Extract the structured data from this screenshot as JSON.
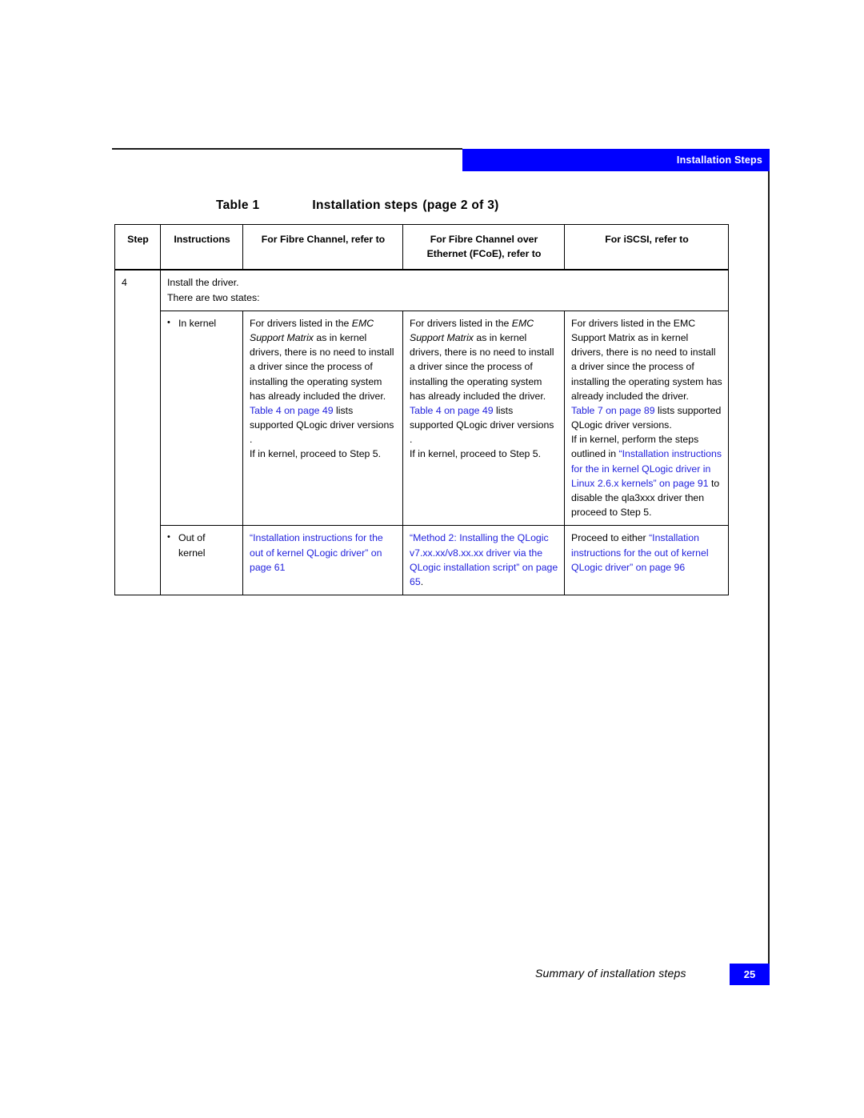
{
  "header": {
    "banner_label": "Installation Steps"
  },
  "caption": {
    "number": "Table 1",
    "title": "Installation steps",
    "continuation": "(page 2 of 3)"
  },
  "table": {
    "columns": [
      "Step",
      "Instructions",
      "For Fibre Channel, refer to",
      "For Fibre Channel over Ethernet (FCoE), refer to",
      "For iSCSI, refer to"
    ],
    "column_fcoe_line1": "For Fibre Channel over",
    "column_fcoe_line2": "Ethernet (FCoE), refer to",
    "step_number": "4",
    "intro_line1": "Install the driver.",
    "intro_line2": "There are two states:",
    "rows": [
      {
        "bullet": "•",
        "state_label": "In kernel",
        "fibre_channel": {
          "p1_a": "For drivers listed in the ",
          "p1_italic": "EMC Support Matrix",
          "p1_b": " as in kernel drivers, there is no need to install a driver since the process of installing the operating system has already included the driver.",
          "p2_link": "Table 4 on page 49",
          "p2_rest": " lists supported QLogic driver versions .",
          "p3": "If in kernel, proceed to Step 5."
        },
        "fcoe": {
          "p1_a": "For drivers listed in the ",
          "p1_italic": "EMC Support Matrix",
          "p1_b": " as in kernel drivers, there is no need to install a driver since the process of installing the operating system has already included the driver.",
          "p2_link": "Table 4 on page 49",
          "p2_rest": " lists supported QLogic driver versions .",
          "p3": "If in kernel, proceed to Step 5."
        },
        "iscsi": {
          "p1": "For drivers listed in the EMC Support Matrix as in kernel drivers, there is no need to install a driver since the process of installing the operating system has already included the driver.",
          "p2_link": "Table 7 on page 89",
          "p2_rest": " lists supported QLogic driver versions.",
          "p3_a": "If in kernel, perform the steps outlined in ",
          "p3_link": "“Installation instructions for the in kernel QLogic driver in Linux 2.6.x kernels” on page 91",
          "p3_b": " to disable the qla3xxx driver then proceed to Step 5."
        }
      },
      {
        "bullet": "•",
        "state_label_line1": "Out of",
        "state_label_line2": "kernel",
        "fibre_channel_link": "“Installation instructions for the out of kernel QLogic driver” on page 61",
        "fcoe_link": "“Method 2: Installing the QLogic v7.xx.xx/v8.xx.xx driver via the QLogic installation script” on page 65",
        "fcoe_link_suffix": ".",
        "iscsi_prefix": "Proceed to either ",
        "iscsi_link": "“Installation instructions for the out of kernel QLogic driver” on page 96"
      }
    ]
  },
  "footer": {
    "running_title": "Summary of installation steps",
    "page_number": "25"
  }
}
